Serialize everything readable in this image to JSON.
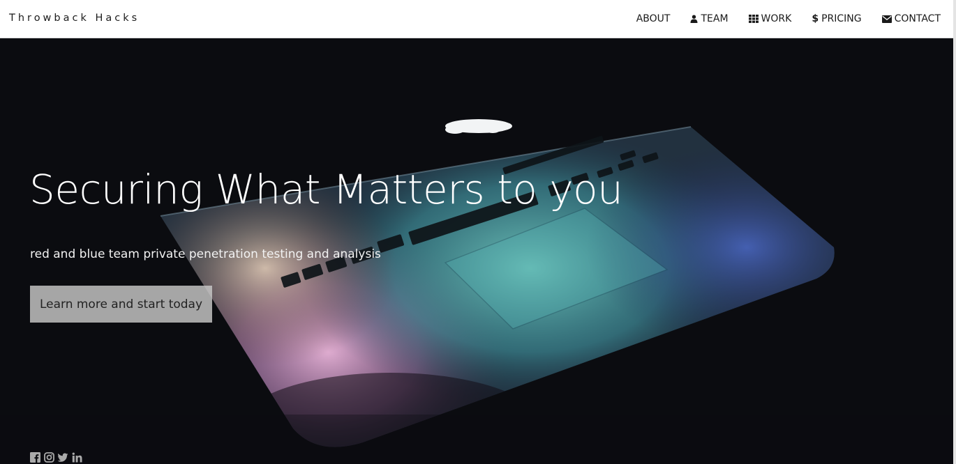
{
  "brand": "Throwback Hacks",
  "nav": [
    {
      "label": "ABOUT",
      "icon": ""
    },
    {
      "label": "TEAM",
      "icon": "user-icon"
    },
    {
      "label": "WORK",
      "icon": "grid-icon"
    },
    {
      "label": "PRICING",
      "icon": "dollar-icon"
    },
    {
      "label": "CONTACT",
      "icon": "envelope-icon"
    }
  ],
  "hero": {
    "title": "Securing What Matters to you",
    "subtitle": "red and blue team private penetration testing and analysis",
    "cta_label": "Learn more and start today"
  },
  "socials": [
    "facebook-icon",
    "instagram-icon",
    "twitter-icon",
    "linkedin-icon"
  ],
  "colors": {
    "nav_bg": "#ffffff",
    "hero_bg": "#0b0c10",
    "cta_bg": "#c8c8c8",
    "social_icon": "#aaaaaa"
  }
}
